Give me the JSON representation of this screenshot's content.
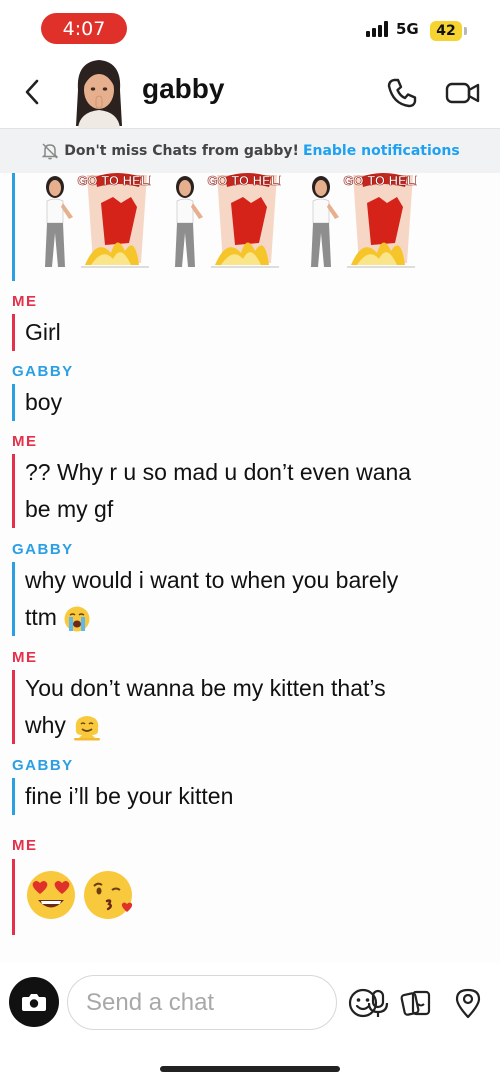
{
  "status_bar": {
    "time": "4:07",
    "network": "5G",
    "battery": "42"
  },
  "header": {
    "contact_name": "gabby",
    "back_icon": "chevron-left-icon",
    "call_icon": "phone-icon",
    "video_icon": "video-camera-icon"
  },
  "notification_banner": {
    "text": "Don't miss Chats from gabby!",
    "link": "Enable notifications",
    "icon": "bell-off-icon"
  },
  "chat": {
    "stickers": [
      {
        "caption": "GO TO HELL"
      },
      {
        "caption": "GO TO HELL"
      },
      {
        "caption": "GO TO HELL"
      }
    ],
    "messages": [
      {
        "sender": "ME",
        "text": "Girl"
      },
      {
        "sender": "GABBY",
        "text": "boy"
      },
      {
        "sender": "ME",
        "text": "?? Why r u so mad u don’t even wana",
        "text2": "be my gf"
      },
      {
        "sender": "GABBY",
        "text": "why would i want to when you barely",
        "text2": "ttm",
        "emoji": "loudly-crying-face"
      },
      {
        "sender": "ME",
        "text": "You don’t wanna be my kitten that’s",
        "text2": "why",
        "emoji": "melting-face"
      },
      {
        "sender": "GABBY",
        "text": "fine i’ll be your kitten"
      },
      {
        "sender": "ME",
        "emojis": [
          "heart-eyes-face",
          "face-blowing-kiss"
        ]
      }
    ]
  },
  "composer": {
    "placeholder": "Send a chat",
    "camera_icon": "camera-icon",
    "mic_icon": "microphone-icon",
    "face_icon": "smiley-icon",
    "sticker_icon": "sticker-icon",
    "location_icon": "location-pin-icon"
  },
  "colors": {
    "me": "#e5304b",
    "gabby": "#2a9fe3",
    "link": "#1ea1f1",
    "time_pill": "#e0302a",
    "battery": "#f5d432"
  }
}
